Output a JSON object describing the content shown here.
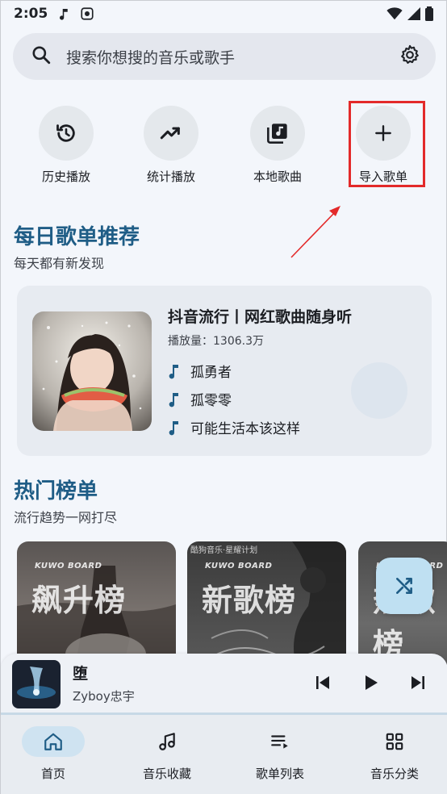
{
  "status_bar": {
    "time": "2:05"
  },
  "search": {
    "placeholder": "搜索你想搜的音乐或歌手"
  },
  "quick_actions": [
    {
      "label": "历史播放",
      "icon": "history-icon"
    },
    {
      "label": "统计播放",
      "icon": "trending-icon"
    },
    {
      "label": "本地歌曲",
      "icon": "library-music-icon"
    },
    {
      "label": "导入歌单",
      "icon": "plus-icon"
    }
  ],
  "daily": {
    "title": "每日歌单推荐",
    "subtitle": "每天都有新发现",
    "playlist": {
      "title": "抖音流行丨网红歌曲随身听",
      "plays": "播放量：1306.3万",
      "songs": [
        "孤勇者",
        "孤零零",
        "可能生活本该这样"
      ]
    }
  },
  "charts": {
    "title": "热门榜单",
    "subtitle": "流行趋势一网打尽",
    "cards": [
      {
        "brand": "KUWO BOARD",
        "name": "飙升榜",
        "note": ""
      },
      {
        "brand": "KUWO BOARD",
        "name": "新歌榜",
        "note": "酷狗音乐·星耀计划"
      },
      {
        "brand": "KUWO BOARD",
        "name": "热歌榜",
        "note": ""
      }
    ]
  },
  "now_playing": {
    "title": "堕",
    "artist": "Zyboy忠宇",
    "progress": 0.0
  },
  "bottom_nav": [
    {
      "label": "首页",
      "icon": "home-icon",
      "active": true
    },
    {
      "label": "音乐收藏",
      "icon": "music-collection-icon",
      "active": false
    },
    {
      "label": "歌单列表",
      "icon": "playlist-icon",
      "active": false
    },
    {
      "label": "音乐分类",
      "icon": "category-grid-icon",
      "active": false
    }
  ],
  "colors": {
    "accent": "#1f5d86",
    "highlight": "#e32a2a",
    "fab": "#bfe0f2"
  }
}
